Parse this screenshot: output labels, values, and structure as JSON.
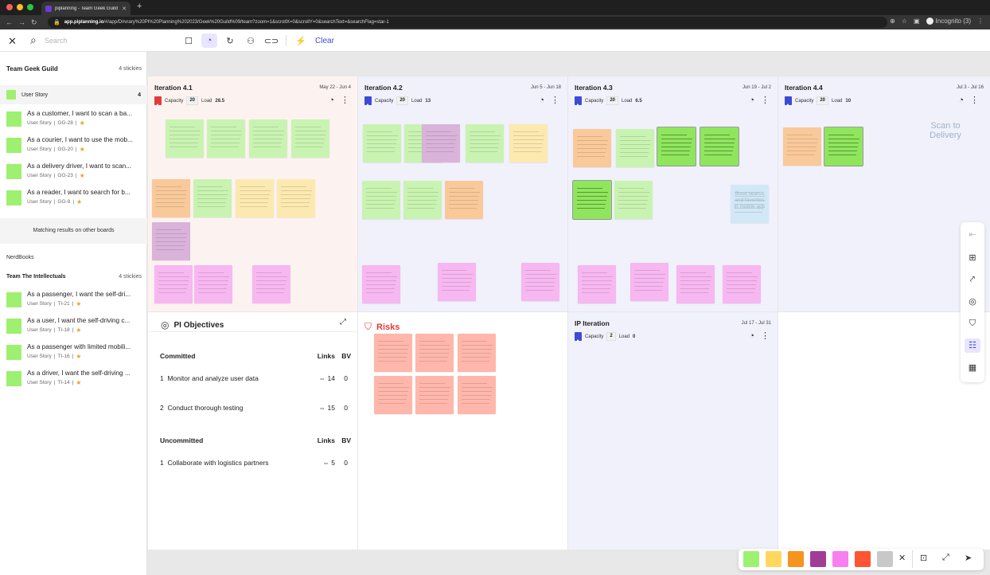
{
  "browser": {
    "tab_title": "piplanning - Team Geek Guild",
    "url_host": "app.piplanning.io",
    "url_path": "/#/app/Drivrary%20PI%20Planning%202023/Geek%20Guild%09/team?zoom=1&scrollX=0&scrollY=0&searchText=&searchFlag=star-1",
    "incognito": "Incognito (3)"
  },
  "toolbar": {
    "search_placeholder": "Search",
    "clear_label": "Clear"
  },
  "sidebar": {
    "team1": {
      "name": "Team Geek Guild",
      "count": "4 stickies",
      "group": {
        "label": "User Story",
        "count": "4"
      },
      "items": [
        {
          "title": "As a customer, I want to scan a ba...",
          "type": "User Story",
          "id": "GG-28"
        },
        {
          "title": "As a courier, I want to use the mob...",
          "type": "User Story",
          "id": "GG-20"
        },
        {
          "title": "As a delivery driver, I want to scan...",
          "type": "User Story",
          "id": "GG-23"
        },
        {
          "title": "As a reader, I want to search for b...",
          "type": "User Story",
          "id": "GG-9"
        }
      ]
    },
    "matching": "Matching results on other boards",
    "board": "NerdBooks",
    "team2": {
      "name": "Team The Intellectuals",
      "count": "4 stickies",
      "items": [
        {
          "title": "As a passenger, I want the self-dri...",
          "type": "User Story",
          "id": "TI-21"
        },
        {
          "title": "As a user, I want the self-driving c...",
          "type": "User Story",
          "id": "TI-18"
        },
        {
          "title": "As a passenger with limited mobili...",
          "type": "User Story",
          "id": "TI-16"
        },
        {
          "title": "As a driver, I want the self-driving ...",
          "type": "User Story",
          "id": "TI-14"
        }
      ]
    }
  },
  "iterations": [
    {
      "title": "Iteration 4.1",
      "dates": "May 22 - Jun 4",
      "capacity_label": "Capacity",
      "capacity": "20",
      "load_label": "Load",
      "load": "28.5",
      "flag": "#e23b3b"
    },
    {
      "title": "Iteration 4.2",
      "dates": "Jun 5 - Jun 18",
      "capacity_label": "Capacity",
      "capacity": "20",
      "load_label": "Load",
      "load": "13",
      "flag": "#3d4bd4"
    },
    {
      "title": "Iteration 4.3",
      "dates": "Jun 19 - Jul 2",
      "capacity_label": "Capacity",
      "capacity": "20",
      "load_label": "Load",
      "load": "6.5",
      "flag": "#3d4bd4"
    },
    {
      "title": "Iteration 4.4",
      "dates": "Jul 3 - Jul 16",
      "capacity_label": "Capacity",
      "capacity": "20",
      "load_label": "Load",
      "load": "10",
      "flag": "#3d4bd4"
    }
  ],
  "ip_iteration": {
    "title": "IP Iteration",
    "dates": "Jul 17 - Jul 31",
    "capacity_label": "Capacity",
    "capacity": "2",
    "load_label": "Load",
    "load": "0",
    "flag": "#3d4bd4"
  },
  "objectives": {
    "title": "PI Objectives",
    "committed": {
      "label": "Committed",
      "links_h": "Links",
      "bv_h": "BV",
      "rows": [
        {
          "n": "1",
          "text": "Monitor and analyze user data",
          "links": "14",
          "bv": "0"
        },
        {
          "n": "2",
          "text": "Conduct thorough testing",
          "links": "15",
          "bv": "0"
        }
      ]
    },
    "uncommitted": {
      "label": "Uncommitted",
      "links_h": "Links",
      "bv_h": "BV",
      "rows": [
        {
          "n": "1",
          "text": "Collaborate with logistics partners",
          "links": "5",
          "bv": "0"
        }
      ]
    }
  },
  "risks": {
    "title": "Risks"
  },
  "faded_notes": {
    "scan": "Scan to Delivery",
    "book": "Book search and favorites in mobile app"
  },
  "palette": {
    "colors": [
      "#9ef070",
      "#ffd75e",
      "#f5941f",
      "#a23d97",
      "#f77ff2",
      "#ff5533",
      "#c8c8c8"
    ]
  },
  "colors": {
    "green": "#c9f3b1",
    "green_hi": "#8fe65c",
    "yellow": "#fbe9b0",
    "orange": "#f9c99a",
    "purple": "#d9b3d9",
    "pink": "#f7b7f0",
    "red": "#ffb7ab",
    "blue": "#d3e8f7",
    "accent": "#3d4bd4"
  }
}
